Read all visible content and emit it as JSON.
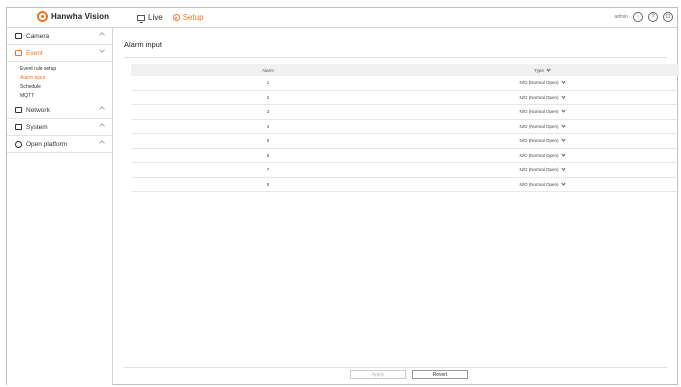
{
  "header": {
    "brand": "Hanwha Vision",
    "nav": [
      {
        "label": "Live"
      },
      {
        "label": "Setup"
      }
    ],
    "user": "admin",
    "help_icon": "?",
    "logout_icon": "⏻"
  },
  "sidebar": {
    "sections": [
      {
        "label": "Camera",
        "icon": "camera-icon"
      },
      {
        "label": "Event",
        "icon": "bell-icon",
        "items": [
          "Event rule setup",
          "Alarm input",
          "Schedule",
          "MQTT"
        ]
      },
      {
        "label": "Network",
        "icon": "monitor-icon"
      },
      {
        "label": "System",
        "icon": "gear-icon"
      },
      {
        "label": "Open platform",
        "icon": "platform-icon"
      }
    ]
  },
  "main": {
    "title": "Alarm input",
    "columns": [
      "Alarm",
      "Type"
    ],
    "rows": [
      {
        "alarm": "1",
        "type": "N/O (Normal Open)"
      },
      {
        "alarm": "2",
        "type": "N/O (Normal Open)"
      },
      {
        "alarm": "3",
        "type": "N/O (Normal Open)"
      },
      {
        "alarm": "4",
        "type": "N/O (Normal Open)"
      },
      {
        "alarm": "5",
        "type": "N/O (Normal Open)"
      },
      {
        "alarm": "6",
        "type": "N/O (Normal Open)"
      },
      {
        "alarm": "7",
        "type": "N/O (Normal Open)"
      },
      {
        "alarm": "8",
        "type": "N/O (Normal Open)"
      }
    ],
    "buttons": {
      "apply": "Apply",
      "revert": "Revert"
    }
  },
  "colors": {
    "accent": "#f37321"
  }
}
